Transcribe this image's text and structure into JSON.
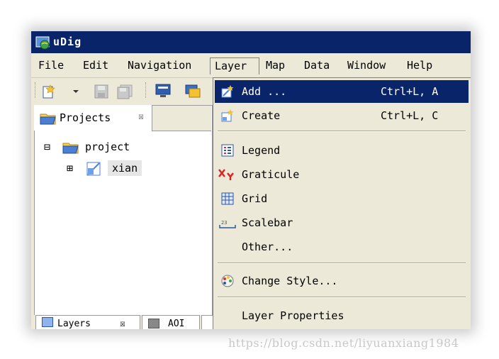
{
  "window": {
    "title": "uDig",
    "app_icon": "udig-globe-icon"
  },
  "menubar": {
    "items": [
      {
        "label": "File"
      },
      {
        "label": "Edit"
      },
      {
        "label": "Navigation"
      },
      {
        "label": "Layer",
        "open": true
      },
      {
        "label": "Map"
      },
      {
        "label": "Data"
      },
      {
        "label": "Window"
      },
      {
        "label": "Help"
      }
    ]
  },
  "toolbar": {
    "buttons": [
      "new-icon",
      "dropdown-arrow-icon",
      "save-icon",
      "save-all-icon",
      "monitor-icon",
      "layers-window-icon"
    ]
  },
  "projects_view": {
    "tab_label": "Projects",
    "close_glyph": "☒",
    "tree": [
      {
        "expander": "⊟",
        "label": "project",
        "icon": "project-folder-icon"
      },
      {
        "expander": "⊞",
        "label": "xian",
        "icon": "map-icon"
      }
    ]
  },
  "bottom_tabs": [
    {
      "label": "Layers",
      "close_glyph": "☒"
    },
    {
      "label": "AOI"
    }
  ],
  "layer_menu": {
    "items": [
      {
        "label": "Add ...",
        "shortcut": "Ctrl+L, A",
        "icon": "add-layer-icon",
        "selected": true
      },
      {
        "label": "Create",
        "shortcut": "Ctrl+L, C",
        "icon": "create-layer-icon"
      },
      {
        "separator": true
      },
      {
        "label": "Legend",
        "icon": "legend-icon"
      },
      {
        "label": "Graticule",
        "icon": "graticule-icon"
      },
      {
        "label": "Grid",
        "icon": "grid-icon"
      },
      {
        "label": "Scalebar",
        "icon": "scalebar-icon"
      },
      {
        "label": "Other..."
      },
      {
        "separator": true
      },
      {
        "label": "Change Style...",
        "icon": "palette-icon"
      },
      {
        "separator": true
      },
      {
        "label": "Layer Properties"
      }
    ]
  },
  "watermark": "https://blog.csdn.net/liyuanxiang1984",
  "colors": {
    "titlebar": "#0a246a",
    "selection": "#0a246a",
    "chrome": "#ece9d8"
  }
}
